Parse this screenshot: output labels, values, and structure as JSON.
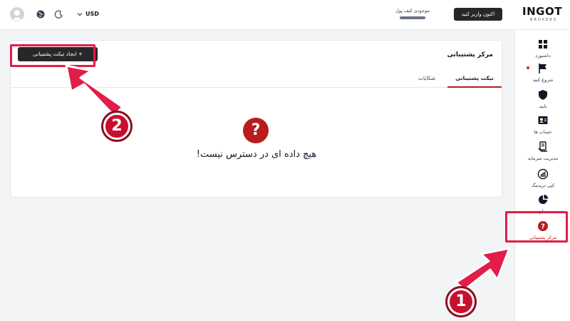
{
  "brand": {
    "logo_text": "INGOT",
    "logo_subtext": "BROKERS"
  },
  "header": {
    "deposit_button": "اکنون واریز کنید",
    "wallet_label": "موجودی کیف پول",
    "currency": "USD"
  },
  "sidebar": {
    "items": [
      {
        "label": "داشبورد",
        "icon": "dashboard-icon"
      },
      {
        "label": "شروع کنید",
        "icon": "flag-icon"
      },
      {
        "label": "تایید",
        "icon": "shield-icon"
      },
      {
        "label": "حساب ها",
        "icon": "accounts-icon"
      },
      {
        "label": "مدیریت سرمایه",
        "icon": "fund-management-icon"
      },
      {
        "label": "کپی تریدینگ",
        "icon": "copy-trading-icon"
      },
      {
        "label": "منابع",
        "icon": "pie-chart-icon"
      },
      {
        "label": "مرکز پشتیبانی",
        "icon": "help-icon",
        "active": true
      }
    ]
  },
  "main": {
    "title": "مرکز پشتیبانی",
    "create_button": "+ ایجاد تیکت پشتیبانی",
    "tabs": [
      {
        "label": "تیکت پشتیبانی",
        "active": true
      },
      {
        "label": "شکایات",
        "active": false
      }
    ],
    "empty_message": "هیچ داده ای در دسترس نیست!"
  },
  "annotations": {
    "step_1": "1",
    "step_2": "2",
    "color": "#c8102e"
  }
}
